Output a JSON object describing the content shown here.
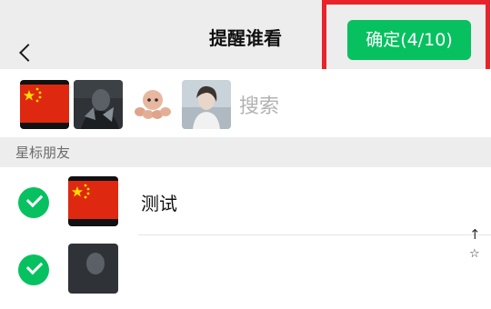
{
  "header": {
    "title": "提醒谁看",
    "confirm_label": "确定(4/10)"
  },
  "search": {
    "placeholder": "搜索"
  },
  "selected_avatars": [
    {
      "name": "china-flag-avatar"
    },
    {
      "name": "dark-portrait-avatar"
    },
    {
      "name": "octopus-toy-avatar"
    },
    {
      "name": "person-photo-avatar"
    }
  ],
  "section": {
    "label": "星标朋友"
  },
  "contacts": [
    {
      "name": "测试",
      "checked": true
    },
    {
      "name": "",
      "checked": true
    }
  ],
  "index_bar": [
    "↑",
    "☆"
  ],
  "colors": {
    "accent": "#07c160",
    "highlight": "#e8232a",
    "flag_red": "#de2910",
    "flag_yellow": "#ffde00"
  }
}
